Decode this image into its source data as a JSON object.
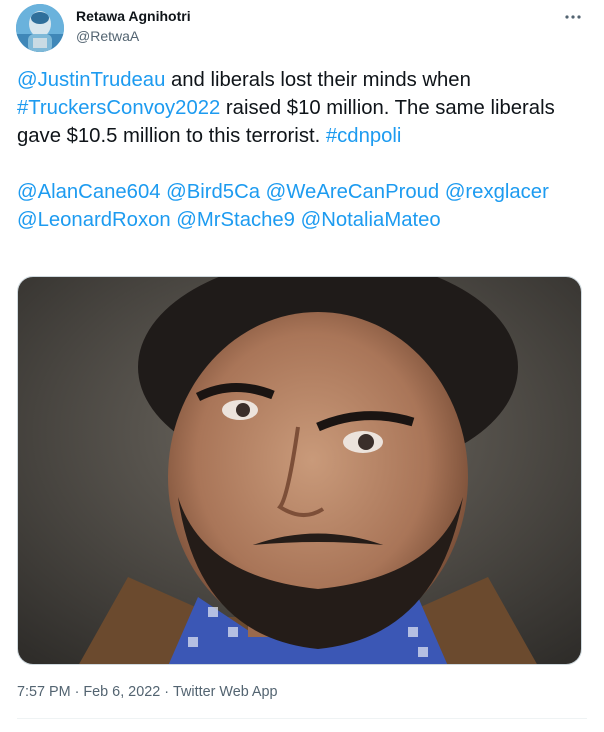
{
  "author": {
    "display_name": "Retawa Agnihotri",
    "handle": "@RetwaA"
  },
  "menu": {
    "more_icon": "more-horizontal-icon",
    "more_glyph": "···"
  },
  "tweet": {
    "paragraph1": [
      {
        "text": "@JustinTrudeau",
        "type": "mention"
      },
      {
        "text": " and liberals lost their minds when ",
        "type": "text"
      },
      {
        "text": "#TruckersConvoy2022",
        "type": "hashtag"
      },
      {
        "text": " raised $10 million. The same liberals gave $10.5 million to this terrorist. ",
        "type": "text"
      },
      {
        "text": "#cdnpoli",
        "type": "hashtag"
      }
    ],
    "paragraph2": [
      {
        "text": "@AlanCane604",
        "type": "mention"
      },
      {
        "text": " ",
        "type": "text"
      },
      {
        "text": "@Bird5Ca",
        "type": "mention"
      },
      {
        "text": " ",
        "type": "text"
      },
      {
        "text": "@WeAreCanProud",
        "type": "mention"
      },
      {
        "text": " ",
        "type": "text"
      },
      {
        "text": "@rexglacer",
        "type": "mention"
      },
      {
        "text": " ",
        "type": "text"
      },
      {
        "text": "@LeonardRoxon",
        "type": "mention"
      },
      {
        "text": " ",
        "type": "text"
      },
      {
        "text": "@MrStache9",
        "type": "mention"
      },
      {
        "text": " ",
        "type": "text"
      },
      {
        "text": "@NotaliaMateo",
        "type": "mention"
      }
    ]
  },
  "media": {
    "kind": "photo"
  },
  "meta": {
    "time": "7:57 PM",
    "separator": "·",
    "date": "Feb 6, 2022",
    "source": "Twitter Web App"
  },
  "colors": {
    "link": "#1d9bf0",
    "text": "#0f1419",
    "secondary": "#536471",
    "border": "#cfd9de"
  }
}
